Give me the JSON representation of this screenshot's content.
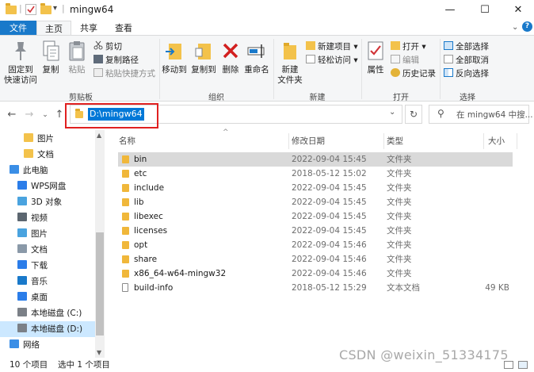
{
  "window": {
    "title": "mingw64",
    "minimize": "—",
    "maximize": "☐",
    "close": "✕"
  },
  "tabs": [
    {
      "label": "文件"
    },
    {
      "label": "主页"
    },
    {
      "label": "共享"
    },
    {
      "label": "查看"
    }
  ],
  "ribbon": {
    "clipboard": {
      "group_label": "剪贴板",
      "pin": "固定到\n快速访问",
      "copy": "复制",
      "paste": "粘贴",
      "cut": "剪切",
      "copy_path": "复制路径",
      "paste_shortcut": "粘贴快捷方式"
    },
    "organize": {
      "group_label": "组织",
      "move_to": "移动到",
      "copy_to": "复制到",
      "delete": "删除",
      "rename": "重命名"
    },
    "new": {
      "group_label": "新建",
      "new_folder": "新建\n文件夹",
      "new_item": "新建项目",
      "easy_access": "轻松访问"
    },
    "open": {
      "group_label": "打开",
      "properties": "属性",
      "open": "打开",
      "edit": "编辑",
      "history": "历史记录"
    },
    "select": {
      "group_label": "选择",
      "select_all": "全部选择",
      "select_none": "全部取消",
      "invert": "反向选择"
    }
  },
  "address": {
    "path": "D:\\mingw64",
    "search_placeholder": "在 mingw64 中搜..."
  },
  "nav": [
    {
      "label": "图片",
      "icon": "folder-icon"
    },
    {
      "label": "文档",
      "icon": "folder-icon"
    },
    {
      "label": "此电脑",
      "icon": "computer-icon"
    },
    {
      "label": "WPS网盘",
      "icon": "cloud-icon"
    },
    {
      "label": "3D 对象",
      "icon": "cube-icon"
    },
    {
      "label": "视频",
      "icon": "video-icon"
    },
    {
      "label": "图片",
      "icon": "picture-icon"
    },
    {
      "label": "文档",
      "icon": "document-icon"
    },
    {
      "label": "下载",
      "icon": "download-icon"
    },
    {
      "label": "音乐",
      "icon": "music-icon"
    },
    {
      "label": "桌面",
      "icon": "desktop-icon"
    },
    {
      "label": "本地磁盘 (C:)",
      "icon": "drive-icon"
    },
    {
      "label": "本地磁盘 (D:)",
      "icon": "drive-icon"
    },
    {
      "label": "网络",
      "icon": "network-icon"
    }
  ],
  "columns": {
    "name": "名称",
    "modified": "修改日期",
    "type": "类型",
    "size": "大小"
  },
  "files": [
    {
      "name": "bin",
      "modified": "2022-09-04 15:45",
      "type": "文件夹",
      "size": ""
    },
    {
      "name": "etc",
      "modified": "2018-05-12 15:02",
      "type": "文件夹",
      "size": ""
    },
    {
      "name": "include",
      "modified": "2022-09-04 15:45",
      "type": "文件夹",
      "size": ""
    },
    {
      "name": "lib",
      "modified": "2022-09-04 15:45",
      "type": "文件夹",
      "size": ""
    },
    {
      "name": "libexec",
      "modified": "2022-09-04 15:45",
      "type": "文件夹",
      "size": ""
    },
    {
      "name": "licenses",
      "modified": "2022-09-04 15:45",
      "type": "文件夹",
      "size": ""
    },
    {
      "name": "opt",
      "modified": "2022-09-04 15:46",
      "type": "文件夹",
      "size": ""
    },
    {
      "name": "share",
      "modified": "2022-09-04 15:46",
      "type": "文件夹",
      "size": ""
    },
    {
      "name": "x86_64-w64-mingw32",
      "modified": "2022-09-04 15:46",
      "type": "文件夹",
      "size": ""
    },
    {
      "name": "build-info",
      "modified": "2018-05-12 15:29",
      "type": "文本文档",
      "size": "49 KB"
    }
  ],
  "status": {
    "count": "10 个项目",
    "selected": "选中 1 个项目"
  },
  "watermark": "CSDN @weixin_51334175",
  "colors": {
    "accent": "#1979ca",
    "selection": "#d9d9d9",
    "highlight_box": "#e02020",
    "folder": "#f0b73a"
  }
}
